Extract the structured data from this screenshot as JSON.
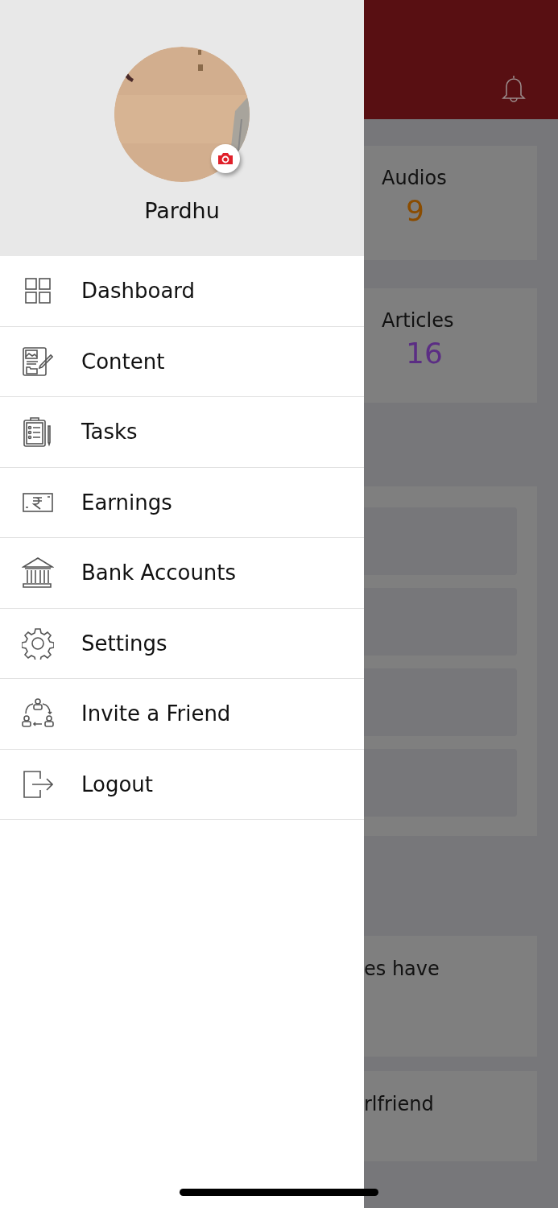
{
  "drawer": {
    "user_name": "Pardhu",
    "menu": [
      {
        "label": "Dashboard"
      },
      {
        "label": "Content"
      },
      {
        "label": "Tasks"
      },
      {
        "label": "Earnings"
      },
      {
        "label": "Bank Accounts"
      },
      {
        "label": "Settings"
      },
      {
        "label": "Invite a Friend"
      },
      {
        "label": "Logout"
      }
    ]
  },
  "background": {
    "stats": [
      {
        "label": "Audios",
        "value": "9",
        "color": "#8a4c00"
      },
      {
        "label": "Articles",
        "value": "16",
        "color": "#5b2d84"
      }
    ],
    "cards": [
      {
        "text": "es have"
      },
      {
        "text": "rlfriend"
      }
    ]
  }
}
